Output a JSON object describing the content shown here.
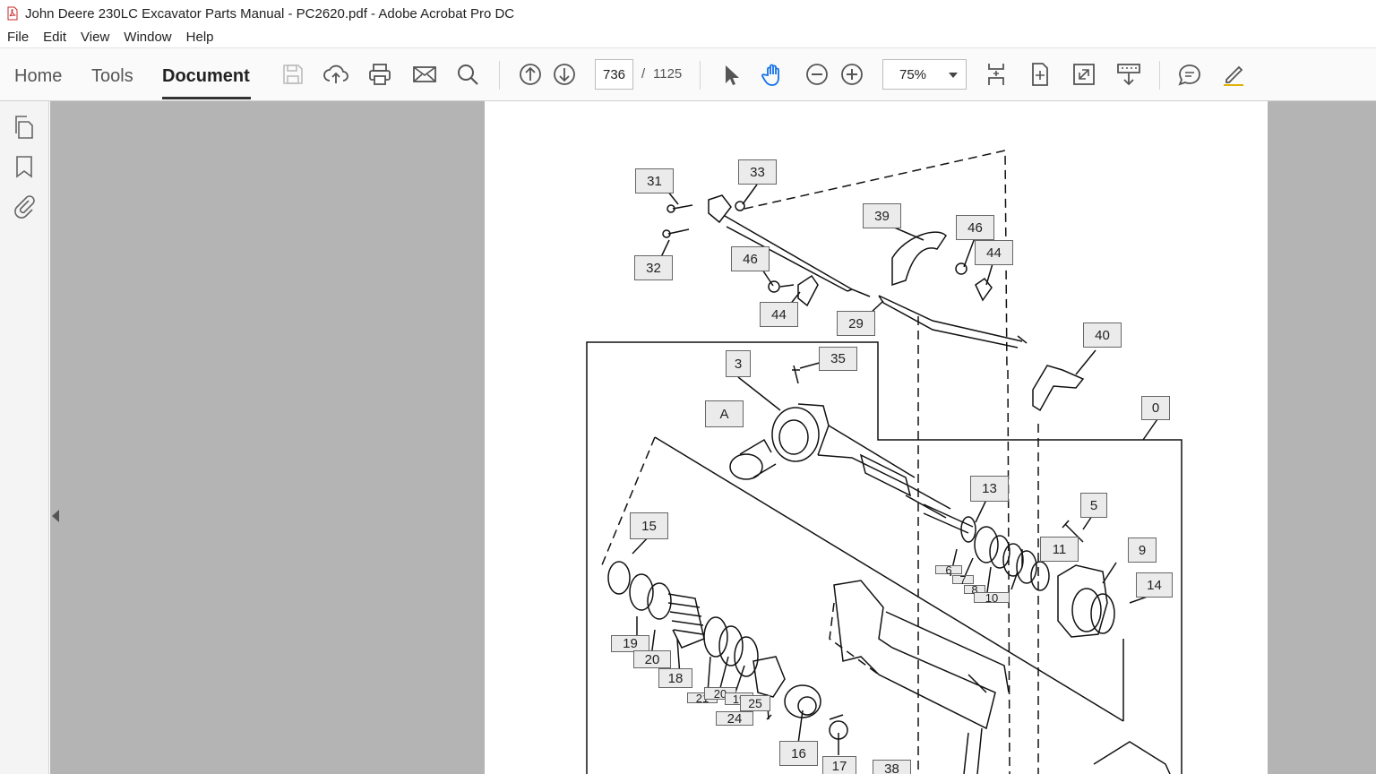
{
  "window": {
    "title": "John Deere 230LC Excavator Parts Manual - PC2620.pdf - Adobe Acrobat Pro DC"
  },
  "menu": {
    "items": [
      "File",
      "Edit",
      "View",
      "Window",
      "Help"
    ]
  },
  "tabs": {
    "home": "Home",
    "tools": "Tools",
    "document": "Document"
  },
  "pager": {
    "current": "736",
    "separator": "/",
    "total": "1125"
  },
  "zoom": {
    "value": "75%"
  },
  "colors": {
    "accent_hand": "#1473e6",
    "viewer_bg": "#b4b4b4"
  },
  "diagram": {
    "callouts": [
      {
        "text": "31"
      },
      {
        "text": "33"
      },
      {
        "text": "39"
      },
      {
        "text": "46"
      },
      {
        "text": "44"
      },
      {
        "text": "32"
      },
      {
        "text": "46"
      },
      {
        "text": "44"
      },
      {
        "text": "29"
      },
      {
        "text": "40"
      },
      {
        "text": "3"
      },
      {
        "text": "35"
      },
      {
        "text": "A"
      },
      {
        "text": "0"
      },
      {
        "text": "13"
      },
      {
        "text": "5"
      },
      {
        "text": "15"
      },
      {
        "text": "11"
      },
      {
        "text": "9"
      },
      {
        "text": "6"
      },
      {
        "text": "7"
      },
      {
        "text": "8"
      },
      {
        "text": "10"
      },
      {
        "text": "14"
      },
      {
        "text": "19"
      },
      {
        "text": "20"
      },
      {
        "text": "18"
      },
      {
        "text": "21"
      },
      {
        "text": "20"
      },
      {
        "text": "19"
      },
      {
        "text": "25"
      },
      {
        "text": "24"
      },
      {
        "text": "16"
      },
      {
        "text": "17"
      },
      {
        "text": "38"
      }
    ]
  }
}
